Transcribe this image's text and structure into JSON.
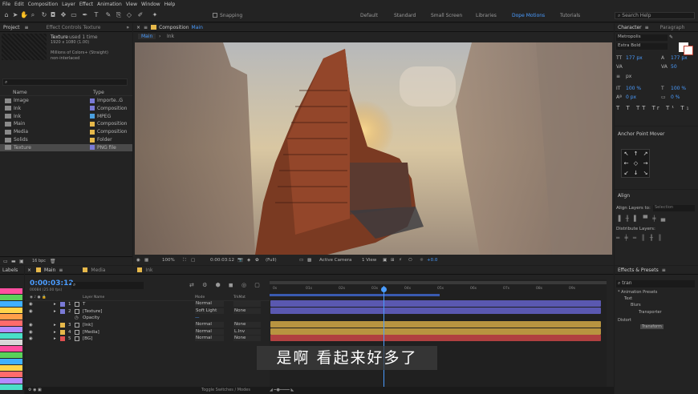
{
  "menu": [
    "File",
    "Edit",
    "Composition",
    "Layer",
    "Effect",
    "Animation",
    "View",
    "Window",
    "Help"
  ],
  "toolbar": {
    "snapping": "Snapping",
    "workspaces": [
      "Default",
      "Standard",
      "Small Screen",
      "Libraries",
      "Dope Motions",
      "Tutorials"
    ],
    "active_workspace": "Dope Motions",
    "search_placeholder": "Search Help"
  },
  "project": {
    "tab": "Project",
    "effect_controls": "Effect Controls Texture",
    "selected_name": "Texture",
    "used": "used 1 time",
    "dims": "1920 x 1080 (1.00)",
    "colors": "Millions of Colors+ (Straight)",
    "interlace": "non-interlaced",
    "col_name": "Name",
    "col_type": "Type",
    "items": [
      {
        "name": "Image",
        "type": "Importe..G",
        "color": "#7a7ad6",
        "icon": "folder"
      },
      {
        "name": "Ink",
        "type": "Composition",
        "color": "#7a7ad6",
        "icon": "comp"
      },
      {
        "name": "Ink",
        "type": "MPEG",
        "color": "#4aa0e0",
        "icon": "film"
      },
      {
        "name": "Main",
        "type": "Composition",
        "color": "#e6b84a",
        "icon": "comp"
      },
      {
        "name": "Media",
        "type": "Composition",
        "color": "#e6b84a",
        "icon": "comp"
      },
      {
        "name": "Solids",
        "type": "Folder",
        "color": "#e6b84a",
        "icon": "folder"
      },
      {
        "name": "Texture",
        "type": "PNG file",
        "color": "#7a7ad6",
        "icon": "file"
      }
    ],
    "bpc": "16 bpc"
  },
  "composition": {
    "tab": "Composition",
    "tab_name": "Main",
    "breadcrumbs": [
      "Main",
      "Ink"
    ],
    "zoom": "100%",
    "timecode": "0:00:03:12",
    "quality": "(Full)",
    "camera": "Active Camera",
    "views": "1 View",
    "exposure": "+0.0"
  },
  "labels": {
    "tab": "Labels",
    "colors": [
      "#ff4fa0",
      "#5ad05a",
      "#3fb0ff",
      "#ffd44a",
      "#ff9f4a",
      "#ff6b6b",
      "#b48cff",
      "#4ae0c8",
      "#d8d8d8",
      "#ff4fa0",
      "#5ad05a",
      "#3fb0ff",
      "#ffd44a",
      "#ff6b6b",
      "#b48cff",
      "#4ae0c8"
    ]
  },
  "timeline": {
    "tabs": [
      "Main",
      "Media",
      "Ink"
    ],
    "timecode": "0:00:03:12",
    "frame_info": "00084 (25.00 fps)",
    "headers": {
      "name": "Layer Name",
      "mode": "Mode",
      "trkmat": "TrkMat"
    },
    "layers": [
      {
        "num": "1",
        "name": "T",
        "mode": "Normal",
        "trkmat": "",
        "color": "#7a7ad6",
        "bar": "#5a58b0"
      },
      {
        "num": "2",
        "name": "[Texture]",
        "mode": "Soft Light",
        "trkmat": "None",
        "color": "#7a7ad6",
        "bar": "#5a58b0"
      },
      {
        "num": "3",
        "name": "[Ink]",
        "mode": "Normal",
        "trkmat": "None",
        "color": "#e6b84a",
        "bar": "#b89440"
      },
      {
        "num": "4",
        "name": "[Media]",
        "mode": "Normal",
        "trkmat": "L.Inv",
        "color": "#e6b84a",
        "bar": "#b89440"
      },
      {
        "num": "5",
        "name": "[BG]",
        "mode": "Normal",
        "trkmat": "None",
        "color": "#e05050",
        "bar": "#b04040"
      }
    ],
    "opacity_label": "Opacity",
    "ruler": [
      "0s",
      "01s",
      "02s",
      "03s",
      "04s",
      "05s",
      "06s",
      "07s",
      "08s",
      "09s"
    ],
    "toggle": "Toggle Switches / Modes"
  },
  "character": {
    "tab": "Character",
    "tab2": "Paragraph",
    "font": "Metropolis",
    "style": "Extra Bold",
    "size": "177 px",
    "leading": "50",
    "px": "px",
    "scale_v": "100 %",
    "scale_h": "100 %",
    "baseline": "0 px",
    "tsume": "0 %"
  },
  "anchor": {
    "title": "Anchor Point Mover"
  },
  "align": {
    "title": "Align",
    "layers_to": "Align Layers to:",
    "selection": "Selection",
    "distribute": "Distribute Layers:"
  },
  "effects": {
    "tab": "Effects & Presets",
    "search": "tran",
    "tree": [
      "* Animation Presets",
      "Text",
      "Blurs",
      "Transporter",
      "Distort",
      "Transform"
    ]
  },
  "subtitle": "是啊 看起来好多了"
}
